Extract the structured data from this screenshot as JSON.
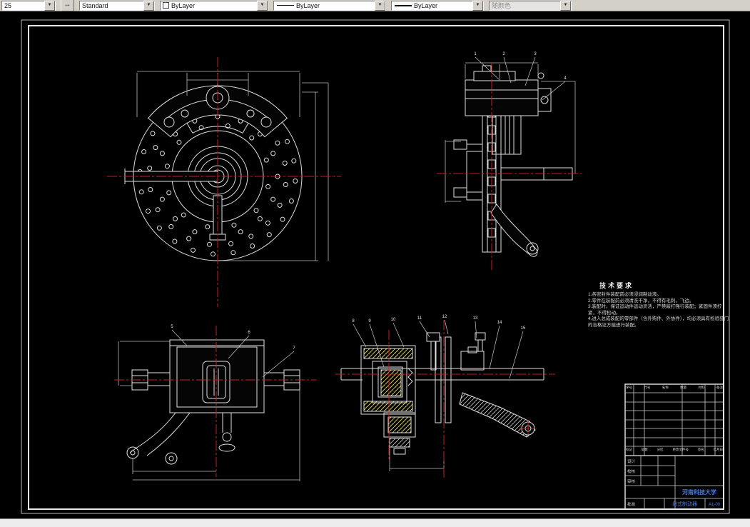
{
  "toolbar": {
    "dropdown_glyph": "▼",
    "scale_combo": {
      "value": "25"
    },
    "style_button_glyph": "↔",
    "style_combo": {
      "value": "Standard"
    },
    "color_combo": {
      "value": "ByLayer"
    },
    "linetype_combo": {
      "value": "ByLayer"
    },
    "lineweight_combo": {
      "value": "ByLayer"
    },
    "plotstyle_combo": {
      "value": "随颜色",
      "disabled": true
    }
  },
  "colors": {
    "canvas_bg": "#000000",
    "drawing_line": "#dfdfdf",
    "centerline_red": "#c81e1e",
    "hatch_yellow": "#d8cf1a",
    "titleblock_blue": "#4a7fe0",
    "toolbar_bg": "#d4d0c8"
  },
  "tech_requirements": {
    "title": "技术要求",
    "lines": [
      "1.各密封件装配前必须浸润制动液。",
      "2.零件在装配前必须清洗干净，不得有毛刺、飞边。",
      "3.装配时，保证运动件运动灵活，严禁敲打强行装配；紧固件须拧紧，不得松动。",
      "4.进入总成装配的零部件（含外购件、外协件），均必须具有检验部门的合格证方能进行装配。"
    ]
  },
  "title_block": {
    "school": "河南科技大学",
    "drawing_title": "盘式制动器",
    "drawing_no": "A1-00",
    "parts_header": [
      "序号",
      "代号",
      "名称",
      "数量",
      "材料",
      "备注"
    ],
    "revision_header": [
      "标记",
      "处数",
      "分区",
      "更改文件号",
      "签名",
      "年月日"
    ],
    "sign_labels": [
      "设计",
      "校核",
      "审核",
      "批准"
    ]
  },
  "balloons": {
    "side": [
      "1",
      "2",
      "3",
      "4"
    ],
    "caliper": [
      "5",
      "6",
      "7"
    ],
    "section": [
      "8",
      "9",
      "10",
      "11",
      "12",
      "13",
      "14",
      "15"
    ]
  }
}
